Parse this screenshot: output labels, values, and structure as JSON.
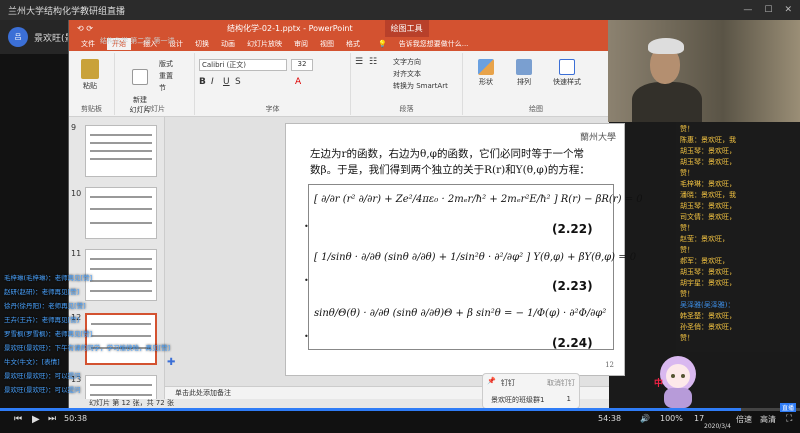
{
  "stream": {
    "title": "兰州大学结构化学教研组直播",
    "host_avatar": "吕",
    "host_name": "景欢旺(景欢旺)",
    "host_extra": "结构化学 第二章 第一讲"
  },
  "ppt": {
    "quick_access": "⟲ ⟳",
    "doc_title": "结构化学-02-1.pptx - PowerPoint",
    "context_tab_group": "绘图工具",
    "tabs": [
      "文件",
      "开始",
      "插入",
      "设计",
      "切换",
      "动画",
      "幻灯片放映",
      "审阅",
      "视图",
      "格式"
    ],
    "active_tab": "开始",
    "tell_me": "告诉我您想要做什么...",
    "ribbon": {
      "paste": "粘贴",
      "new_slide": "新建\n幻灯片",
      "layout": "版式",
      "reset": "重置",
      "section": "节",
      "font_name": "Calibri (正文)",
      "font_size": "32",
      "text_direction": "文字方向",
      "align_text": "对齐文本",
      "convert_smartart": "转换为 SmartArt",
      "shape": "形状",
      "arrange": "排列",
      "quick_styles": "快速样式",
      "groups": [
        "剪贴板",
        "幻灯片",
        "字体",
        "段落",
        "绘图"
      ]
    },
    "thumb_numbers": [
      "9",
      "10",
      "11",
      "12",
      "13"
    ],
    "slide": {
      "logo": "蘭州大學",
      "intro_line1": "左边为r的函数，右边为θ,φ的函数，它们必同时等于一个常",
      "intro_line2": "数β。于是，我们得到两个独立的关于R(r)和Y(θ,φ)的方程：",
      "eq1": "[ ∂/∂r (r² ∂/∂r) + Ze²/4πε₀ · 2mₑr/ħ² + 2mₑr²E/ħ² ] R(r) − βR(r) = 0",
      "eq1_num": "(2.22)",
      "eq2": "[ 1/sinθ · ∂/∂θ (sinθ ∂/∂θ) + 1/sin²θ · ∂²/∂φ² ] Y(θ,φ) + βY(θ,φ) = 0",
      "eq2_num": "(2.23)",
      "eq3": "sinθ/Θ(θ) · ∂/∂θ (sinθ ∂/∂θ)Θ + β sin²θ = − 1/Φ(φ) · ∂²Φ/∂φ²",
      "eq3_num": "(2.24)",
      "page_num": "12"
    },
    "notes_placeholder": "单击此处添加备注",
    "status": "幻灯片 第 12 张，共 72 张"
  },
  "chat": {
    "messages": [
      "赞！",
      "陈惠：景欢旺，我",
      "胡玉琴：景欢旺，",
      "胡玉琴：景欢旺，",
      "赞！",
      "毛梓琳：景欢旺，",
      "潘晓：景欢旺，我",
      "胡玉琴：景欢旺，",
      "司文倩：景欢旺，",
      "赞！",
      "赵莹：景欢旺，",
      "赞！",
      "郝军：景欢旺，",
      "胡玉琴：景欢旺，",
      "胡宇星：景欢旺，",
      "赞！",
      "吴泽雅(吴泽雅)：",
      "韩圣楚：景欢旺，",
      "孙圣俏：景欢旺，",
      "赞！"
    ]
  },
  "overlay": {
    "messages": [
      "毛梓琳(毛梓琳)：老师再见[赞]",
      "赵研(赵研)：老师再见[赞]",
      "徐丹(徐丹阳)：老师再见[赞]",
      "王卉(王卉)：老师再见[赞]",
      "罗雪枫(罗雪枫)：老师再见[赞]",
      "景欢旺(景欢旺)：下午有课的同学，学习愉快哈，再见[赞]",
      "牛文(牛文)：[表情]",
      "景欢旺(景欢旺)：可以提问",
      "景欢旺(景欢旺)：可以提问"
    ]
  },
  "popup": {
    "pin": "钉钉",
    "cancel_pin": "取消钉钉",
    "item": "景欢旺的班级群1",
    "count": "1"
  },
  "mascot_label": "中",
  "player": {
    "current_time": "50:38",
    "total_time": "54:38",
    "progress": 0.926,
    "clock": "17",
    "date": "2020/3/4",
    "speed": "倍速",
    "quality": "高清",
    "zoom": "100%",
    "badge": "直播"
  },
  "colors": {
    "ppt_accent": "#d35230",
    "chat_highlight": "#f5c542",
    "chat_blue": "#3d8fe8",
    "overlay_text": "#4aa3ff"
  }
}
